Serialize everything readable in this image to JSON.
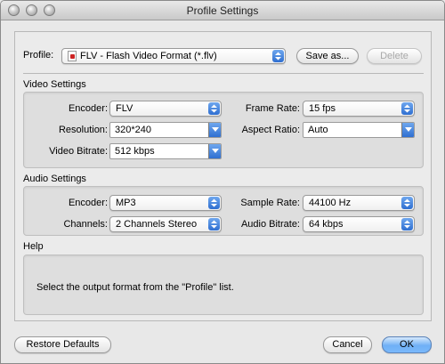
{
  "window": {
    "title": "Profile Settings"
  },
  "profile": {
    "label": "Profile:",
    "value": "FLV - Flash Video Format (*.flv)",
    "save_as_label": "Save as...",
    "delete_label": "Delete"
  },
  "video": {
    "section_title": "Video Settings",
    "encoder_label": "Encoder:",
    "encoder_value": "FLV",
    "frame_rate_label": "Frame Rate:",
    "frame_rate_value": "15 fps",
    "resolution_label": "Resolution:",
    "resolution_value": "320*240",
    "aspect_ratio_label": "Aspect Ratio:",
    "aspect_ratio_value": "Auto",
    "bitrate_label": "Video Bitrate:",
    "bitrate_value": "512 kbps"
  },
  "audio": {
    "section_title": "Audio Settings",
    "encoder_label": "Encoder:",
    "encoder_value": "MP3",
    "sample_rate_label": "Sample Rate:",
    "sample_rate_value": "44100 Hz",
    "channels_label": "Channels:",
    "channels_value": "2 Channels Stereo",
    "bitrate_label": "Audio Bitrate:",
    "bitrate_value": "64 kbps"
  },
  "help": {
    "section_title": "Help",
    "text": "Select the output format from the \"Profile\" list."
  },
  "footer": {
    "restore_label": "Restore Defaults",
    "cancel_label": "Cancel",
    "ok_label": "OK"
  },
  "colors": {
    "accent_blue": "#2f6fd1",
    "window_bg": "#e8e8e8",
    "group_bg": "#dedede"
  }
}
